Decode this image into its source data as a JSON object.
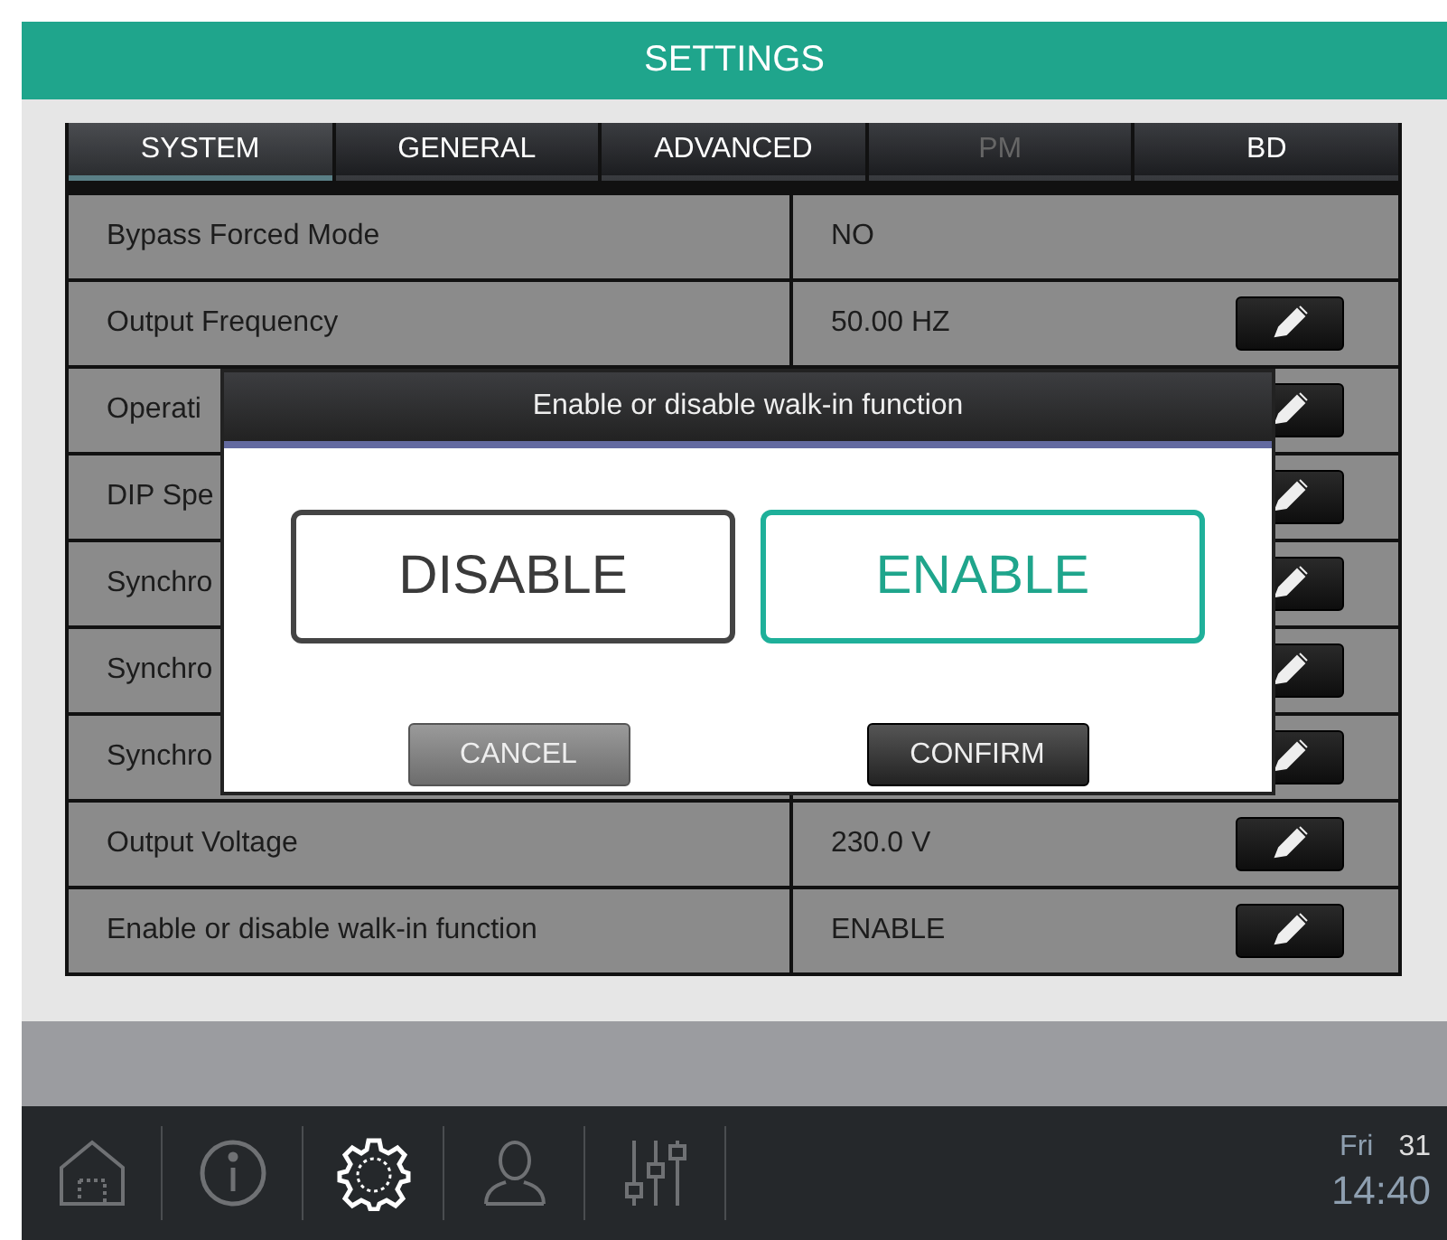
{
  "header": {
    "title": "SETTINGS"
  },
  "tabs": [
    {
      "label": "SYSTEM",
      "selected": true,
      "disabled": false
    },
    {
      "label": "GENERAL",
      "selected": false,
      "disabled": false
    },
    {
      "label": "ADVANCED",
      "selected": false,
      "disabled": false
    },
    {
      "label": "PM",
      "selected": false,
      "disabled": true
    },
    {
      "label": "BD",
      "selected": false,
      "disabled": false
    }
  ],
  "rows": [
    {
      "label": "Bypass Forced Mode",
      "value": "NO",
      "editable": false
    },
    {
      "label": "Output Frequency",
      "value": "50.00 HZ",
      "editable": true
    },
    {
      "label": "Operati",
      "editable": true
    },
    {
      "label": "DIP Spe",
      "editable": true
    },
    {
      "label": "Synchro",
      "editable": true
    },
    {
      "label": "Synchro",
      "editable": true
    },
    {
      "label": "Synchro",
      "editable": true
    },
    {
      "label": "Output Voltage",
      "value": "230.0 V",
      "editable": true
    },
    {
      "label": "Enable or disable walk-in function",
      "value": "ENABLE",
      "editable": true
    }
  ],
  "dialog": {
    "title": "Enable or disable walk-in function",
    "options": [
      {
        "label": "DISABLE",
        "selected": false
      },
      {
        "label": "ENABLE",
        "selected": true
      }
    ],
    "buttons": [
      {
        "label": "CANCEL",
        "kind": "secondary"
      },
      {
        "label": "CONFIRM",
        "kind": "primary"
      }
    ]
  },
  "nav": [
    {
      "kind": "home",
      "selected": false
    },
    {
      "kind": "info",
      "selected": false
    },
    {
      "kind": "settings",
      "selected": true
    },
    {
      "kind": "user",
      "selected": false
    },
    {
      "kind": "sliders",
      "selected": false
    }
  ],
  "clock": {
    "day": "Fri",
    "date": "31",
    "time": "14:40"
  }
}
